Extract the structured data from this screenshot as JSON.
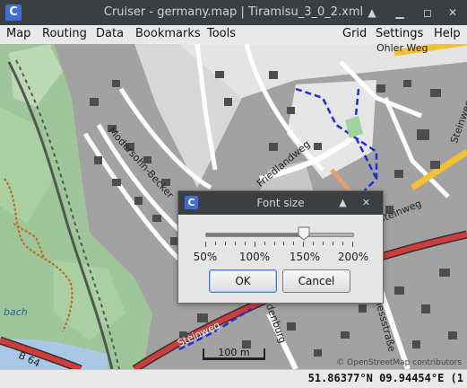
{
  "window": {
    "title": "Cruiser - germany.map | Tiramisu_3_0_2.xml",
    "icon_letter": "C"
  },
  "menu": {
    "left": [
      {
        "label": "Map"
      },
      {
        "label": "Routing"
      },
      {
        "label": "Data"
      },
      {
        "label": "Bookmarks"
      },
      {
        "label": "Tools"
      }
    ],
    "right": [
      {
        "label": "Grid"
      },
      {
        "label": "Settings"
      },
      {
        "label": "Help"
      }
    ]
  },
  "map": {
    "scale_label": "100 m",
    "attribution": "© OpenStreetMap contributors",
    "street_labels": [
      "Modersohn-Becker",
      "Friedlandweg",
      "Steinweg",
      "Steinweg",
      "Hindenburg",
      "Schessstraße",
      "B 64",
      "Ohler Weg",
      "Steinweg",
      "bach"
    ]
  },
  "status": {
    "coordinates": "51.86377°N 09.94454°E (1"
  },
  "dialog": {
    "title": "Font size",
    "icon_letter": "C",
    "slider": {
      "value_percent": 150,
      "min_percent": 50,
      "max_percent": 200
    },
    "tick_labels": [
      "50%",
      "100%",
      "150%",
      "200%"
    ],
    "ok_label": "OK",
    "cancel_label": "Cancel"
  }
}
